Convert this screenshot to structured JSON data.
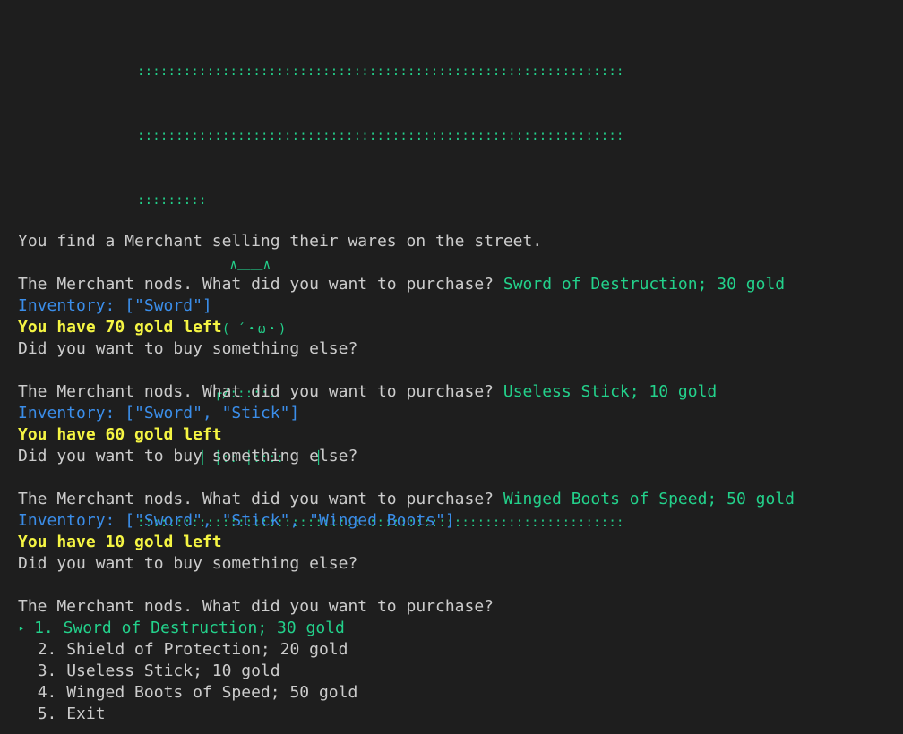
{
  "art": {
    "rows": [
      ":::::::::::::::::::::::::::::::::::::::::::::::::::::::::::::::",
      ":::::::::::::::::::::::::::::::::::::::::::::::::::::::::::::::",
      ":::::::::",
      "            ∧＿＿∧",
      "           ( ´・ω・)",
      "          ┌/::::::",
      "        │ │:: │::::    │",
      ":::::::::::::::::::::::::::::::::::::::::::::::::::::::::::::::"
    ]
  },
  "intro": "You find a Merchant selling their wares on the street.",
  "prompt": "The Merchant nods. What did you want to purchase?",
  "transactions": [
    {
      "choice": "Sword of Destruction; 30 gold",
      "inventory": "Inventory: [\"Sword\"]",
      "gold": "You have 70 gold left",
      "again": "Did you want to buy something else?"
    },
    {
      "choice": "Useless Stick; 10 gold",
      "inventory": "Inventory: [\"Sword\", \"Stick\"]",
      "gold": "You have 60 gold left",
      "again": "Did you want to buy something else?"
    },
    {
      "choice": "Winged Boots of Speed; 50 gold",
      "inventory": "Inventory: [\"Sword\", \"Stick\", \"Winged Boots\"]",
      "gold": "You have 10 gold left",
      "again": "Did you want to buy something else?"
    }
  ],
  "menu": {
    "pointer": "‣",
    "options": [
      "1. Sword of Destruction; 30 gold",
      "2. Shield of Protection; 20 gold",
      "3. Useless Stick; 10 gold",
      "4. Winged Boots of Speed; 50 gold",
      "5. Exit"
    ],
    "selected_index": 0
  },
  "colors": {
    "background": "#1e1e1e",
    "text": "#cccccc",
    "accent_green": "#23d18b",
    "inventory_blue": "#3b8eea",
    "gold_yellow": "#f5f543"
  }
}
